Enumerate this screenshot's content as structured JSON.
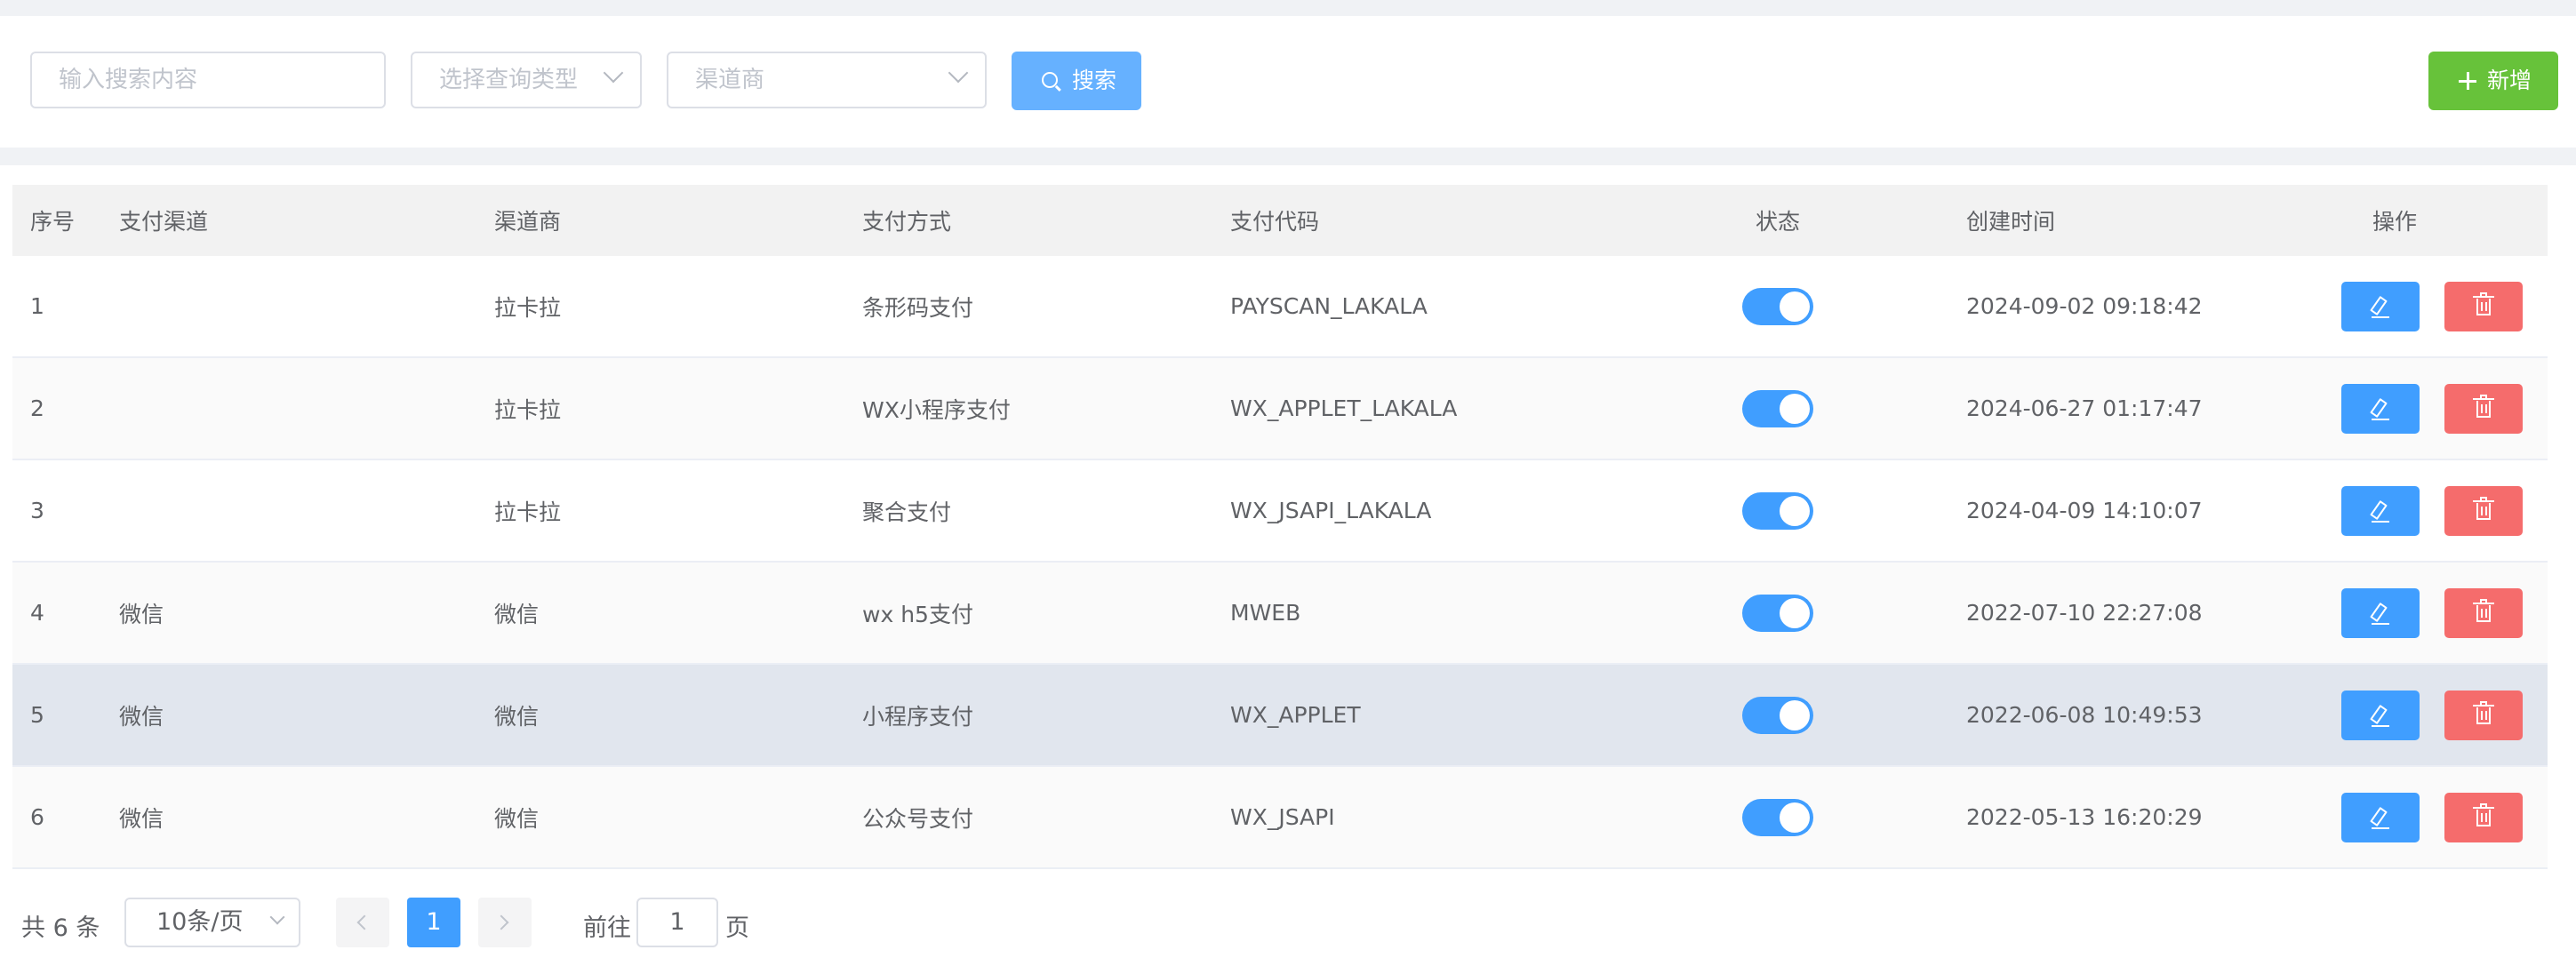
{
  "toolbar": {
    "search_placeholder": "输入搜索内容",
    "query_type_placeholder": "选择查询类型",
    "channel_vendor_placeholder": "渠道商",
    "search_label": "搜索",
    "add_label": "新增"
  },
  "table": {
    "headers": [
      "序号",
      "支付渠道",
      "渠道商",
      "支付方式",
      "支付代码",
      "状态",
      "创建时间",
      "操作"
    ],
    "rows": [
      {
        "index": "1",
        "channel": "",
        "vendor": "拉卡拉",
        "method": "条形码支付",
        "code": "PAYSCAN_LAKALA",
        "enabled": true,
        "created": "2024-09-02 09:18:42"
      },
      {
        "index": "2",
        "channel": "",
        "vendor": "拉卡拉",
        "method": "WX小程序支付",
        "code": "WX_APPLET_LAKALA",
        "enabled": true,
        "created": "2024-06-27 01:17:47"
      },
      {
        "index": "3",
        "channel": "",
        "vendor": "拉卡拉",
        "method": "聚合支付",
        "code": "WX_JSAPI_LAKALA",
        "enabled": true,
        "created": "2024-04-09 14:10:07"
      },
      {
        "index": "4",
        "channel": "微信",
        "vendor": "微信",
        "method": "wx h5支付",
        "code": "MWEB",
        "enabled": true,
        "created": "2022-07-10 22:27:08"
      },
      {
        "index": "5",
        "channel": "微信",
        "vendor": "微信",
        "method": "小程序支付",
        "code": "WX_APPLET",
        "enabled": true,
        "created": "2022-06-08 10:49:53"
      },
      {
        "index": "6",
        "channel": "微信",
        "vendor": "微信",
        "method": "公众号支付",
        "code": "WX_JSAPI",
        "enabled": true,
        "created": "2022-05-13 16:20:29"
      }
    ]
  },
  "pagination": {
    "total": "共 6 条",
    "page_size": "10条/页",
    "current_page": "1",
    "goto_label": "前往",
    "goto_value": "1",
    "goto_unit": "页"
  },
  "colors": {
    "primary": "#409eff",
    "search_button": "#66b1ff",
    "add_button": "#67c23a",
    "delete_button": "#f56c6c",
    "highlight_row": "#e1e6ee"
  }
}
